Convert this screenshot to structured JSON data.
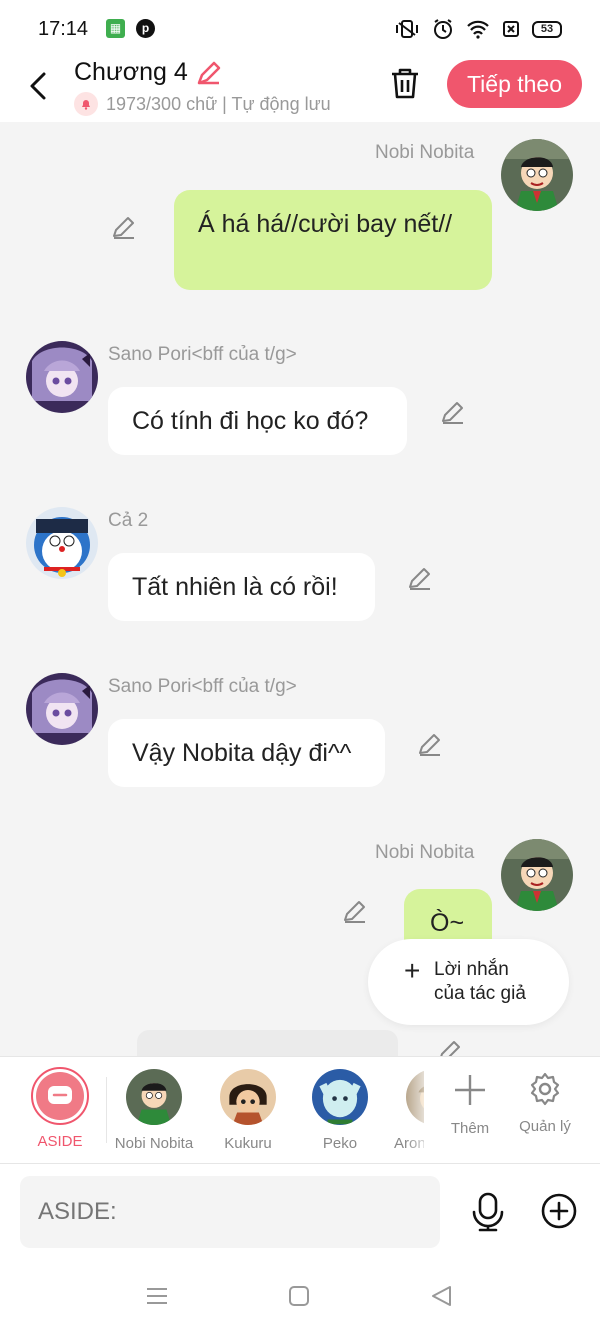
{
  "status_bar": {
    "time": "17:14",
    "battery": "53"
  },
  "header": {
    "title": "Chương 4",
    "subtitle": "1973/300 chữ | Tự động lưu",
    "next_label": "Tiếp theo"
  },
  "messages": [
    {
      "sender": "Nobi Nobita",
      "side": "right",
      "text": "Á há há//cười bay nết//"
    },
    {
      "sender": "Sano Pori<bff của t/g>",
      "side": "left",
      "text": "Có tính đi học ko đó?"
    },
    {
      "sender": "Cả 2",
      "side": "left",
      "text": "Tất nhiên là có rồi!"
    },
    {
      "sender": "Sano Pori<bff của t/g>",
      "side": "left",
      "text": "Vậy Nobita dậy đi^^"
    },
    {
      "sender": "Nobi Nobita",
      "side": "right",
      "text": "Ò~"
    }
  ],
  "author_note": {
    "line1": "Lời nhắn",
    "line2": "của tác giả"
  },
  "characters": {
    "aside": "ASIDE",
    "list": [
      "Nobi Nobita",
      "Kukuru",
      "Peko",
      "Aron"
    ],
    "add_label": "Thêm",
    "manage_label": "Quản lý"
  },
  "input": {
    "placeholder": "ASIDE:"
  },
  "colors": {
    "accent": "#f0566d",
    "bubble_green": "#d6f39b",
    "bubble_white": "#ffffff"
  }
}
